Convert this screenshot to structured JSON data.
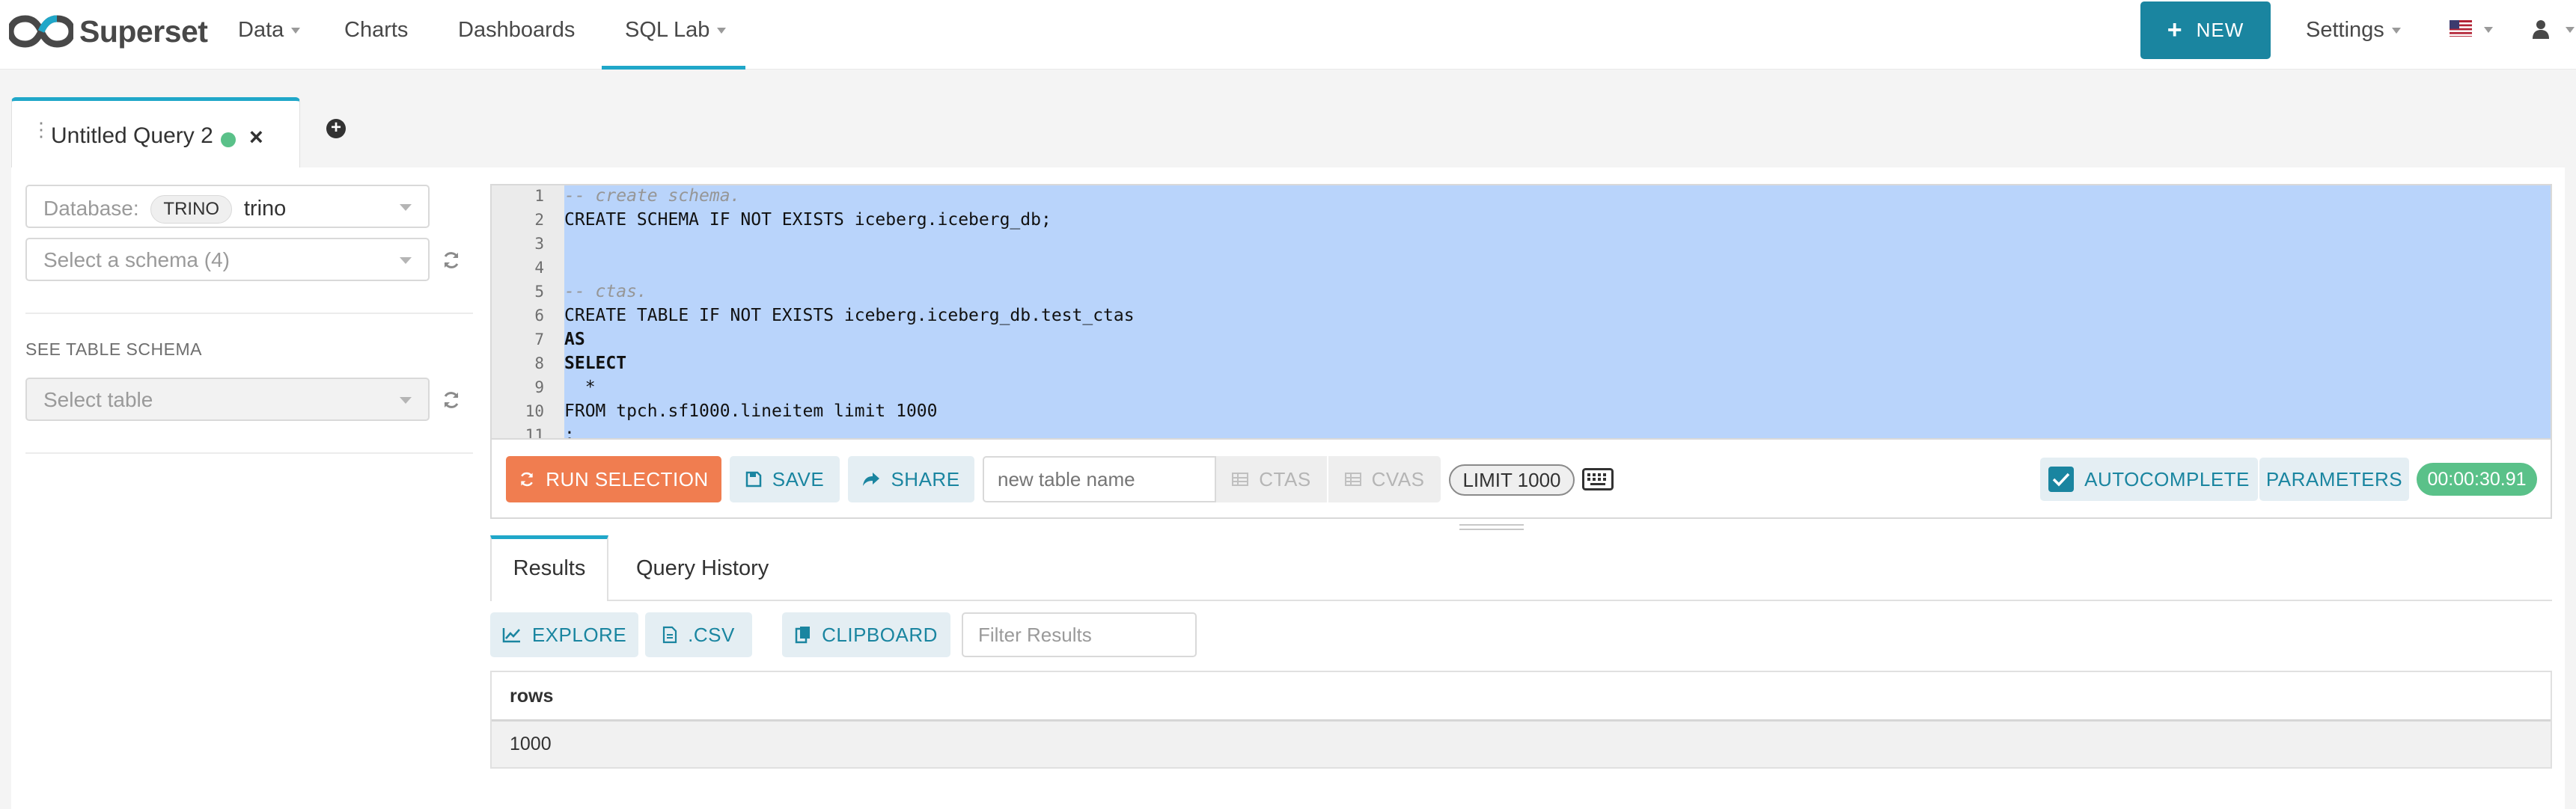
{
  "app": {
    "name": "Superset"
  },
  "nav": {
    "data": "Data",
    "charts": "Charts",
    "dashboards": "Dashboards",
    "sql_lab": "SQL Lab",
    "new_button": "NEW",
    "settings": "Settings"
  },
  "query_tab": {
    "title": "Untitled Query 2",
    "status": "success"
  },
  "sidebar": {
    "database_label": "Database:",
    "database_tag": "TRINO",
    "database_value": "trino",
    "schema_placeholder": "Select a schema (4)",
    "see_table_schema": "SEE TABLE SCHEMA",
    "table_placeholder": "Select table"
  },
  "editor": {
    "line_numbers": [
      "1",
      "2",
      "3",
      "4",
      "5",
      "6",
      "7",
      "8",
      "9",
      "10",
      "11"
    ],
    "lines": [
      "-- create schema.",
      "CREATE SCHEMA IF NOT EXISTS iceberg.iceberg_db;",
      "",
      "",
      "-- ctas.",
      "CREATE TABLE IF NOT EXISTS iceberg.iceberg_db.test_ctas",
      "AS",
      "SELECT",
      "  *",
      "FROM tpch.sf1000.lineitem limit 1000",
      ";"
    ]
  },
  "toolbar": {
    "run_selection": "RUN SELECTION",
    "save": "SAVE",
    "share": "SHARE",
    "new_table_placeholder": "new table name",
    "ctas": "CTAS",
    "cvas": "CVAS",
    "limit": "LIMIT 1000",
    "autocomplete": "AUTOCOMPLETE",
    "parameters": "PARAMETERS",
    "timer": "00:00:30.91"
  },
  "results": {
    "tabs": [
      "Results",
      "Query History"
    ],
    "explore": "EXPLORE",
    "csv": ".CSV",
    "clipboard": "CLIPBOARD",
    "filter_placeholder": "Filter Results",
    "columns": [
      "rows"
    ],
    "rows": [
      [
        "1000"
      ]
    ]
  },
  "colors": {
    "accent": "#20a7c9",
    "primary": "#1a85a0",
    "run_button": "#f07d50",
    "success": "#5ac189",
    "selection": "#b9d4fb"
  }
}
